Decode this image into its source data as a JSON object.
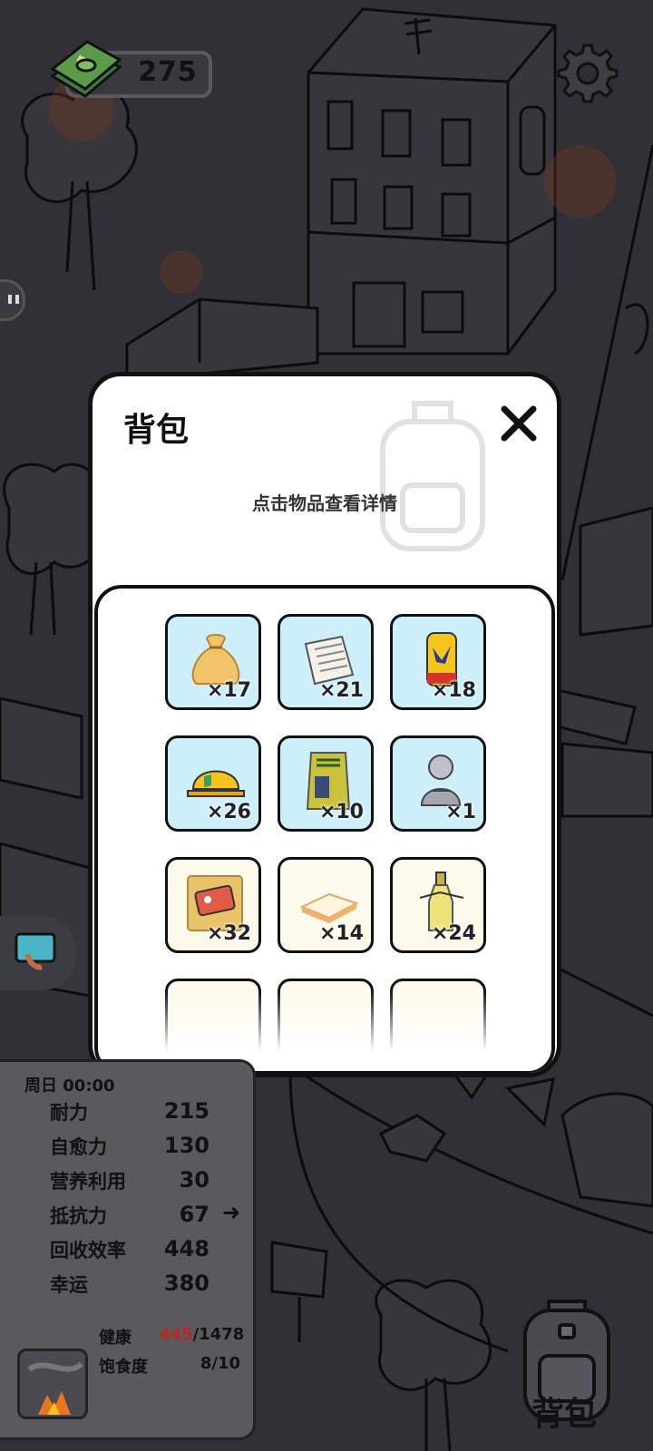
{
  "hud": {
    "money": "275",
    "money_icon": "cash-stack-icon",
    "settings_icon": "gear-icon"
  },
  "backpack": {
    "title": "背包",
    "hint": "点击物品查看详情",
    "close_icon": "close-icon",
    "items": [
      {
        "icon": "sack-icon",
        "qty": "×17",
        "bg": "#cdeffa"
      },
      {
        "icon": "newspaper-icon",
        "qty": "×21",
        "bg": "#cdeffa"
      },
      {
        "icon": "soda-can-icon",
        "qty": "×18",
        "bg": "#cdeffa"
      },
      {
        "icon": "hard-hat-icon",
        "qty": "×26",
        "bg": "#cdeffa"
      },
      {
        "icon": "grain-bag-icon",
        "qty": "×10",
        "bg": "#cdeffa"
      },
      {
        "icon": "buddha-statue-icon",
        "qty": "×1",
        "bg": "#cdeffa"
      },
      {
        "icon": "card-icon",
        "qty": "×32",
        "bg": "#fdfaec"
      },
      {
        "icon": "sponge-icon",
        "qty": "×14",
        "bg": "#fdfaec"
      },
      {
        "icon": "bottle-icon",
        "qty": "×24",
        "bg": "#fdfaec"
      }
    ]
  },
  "stats": {
    "time": "周日 00:00",
    "rows": [
      {
        "label": "耐力",
        "value": "215"
      },
      {
        "label": "自愈力",
        "value": "130"
      },
      {
        "label": "营养利用",
        "value": "30"
      },
      {
        "label": "抵抗力",
        "value": "67"
      },
      {
        "label": "回收效率",
        "value": "448"
      },
      {
        "label": "幸运",
        "value": "380"
      }
    ],
    "health_label": "健康",
    "health_current": "445",
    "health_max": "/1478",
    "satiety_label": "饱食度",
    "satiety_value": "8/10",
    "health_color": "#b52a22"
  },
  "bottom": {
    "backpack_label": "背包",
    "backpack_icon": "backpack-icon"
  }
}
